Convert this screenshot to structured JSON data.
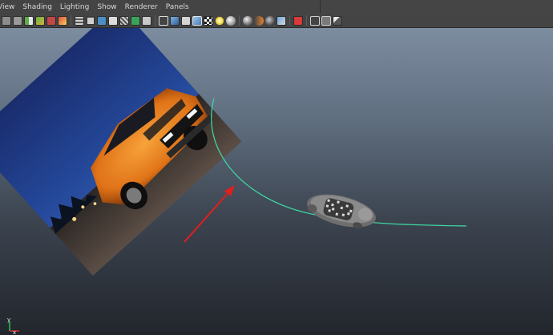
{
  "panel_menu": {
    "items": [
      {
        "label": "View"
      },
      {
        "label": "Shading"
      },
      {
        "label": "Lighting"
      },
      {
        "label": "Show"
      },
      {
        "label": "Renderer"
      },
      {
        "label": "Panels"
      }
    ]
  },
  "toolbar": {
    "icons": [
      "select-camera-icon",
      "camera-attributes-icon",
      "bookmarks-icon",
      "image-plane-icon",
      "2d-pan-zoom-icon",
      "grease-pencil-icon",
      "grid-icon",
      "film-gate-icon",
      "resolution-gate-icon",
      "gate-mask-icon",
      "field-chart-icon",
      "safe-action-icon",
      "safe-title-icon",
      "wireframe-icon",
      "smooth-shade-icon",
      "default-material-icon",
      "wireframe-on-shaded-icon",
      "textured-icon",
      "use-all-lights-icon",
      "shadows-icon",
      "screen-space-ambient-occlusion-icon",
      "motion-blur-icon",
      "multisample-anti-aliasing-icon",
      "depth-of-field-icon",
      "isolate-select-icon",
      "xray-icon",
      "xray-joints-icon",
      "xray-components-icon"
    ]
  },
  "viewport": {
    "axis_labels": {
      "x": "x",
      "y": "y"
    },
    "colors": {
      "motion_path": "#3fd6a0",
      "arrow": "#e0201c",
      "gradient_top": "#7d8da0",
      "gradient_bottom": "#22262c"
    }
  }
}
